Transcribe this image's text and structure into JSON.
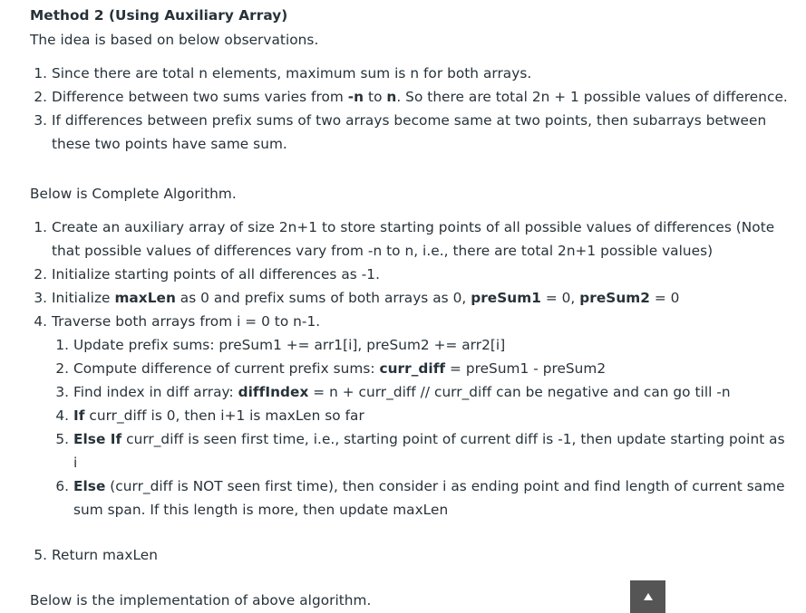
{
  "heading": "Method 2 (Using Auxiliary Array)",
  "intro": "The idea is based on below observations.",
  "observations": {
    "o1": "Since there are total n elements, maximum sum is n for both arrays.",
    "o2": {
      "a": "Difference between two sums varies from ",
      "b1": "-n",
      "b": " to ",
      "b2": "n",
      "c": ". So there are total 2n + 1 possible values of difference."
    },
    "o3": "If differences between prefix sums of two arrays become same at two points, then subarrays between these two points have same sum."
  },
  "algorithm_intro": "Below is Complete Algorithm.",
  "steps": {
    "s1": "Create an auxiliary array of size 2n+1 to store starting points of all possible values of differences (Note that possible values of differences vary from -n to n, i.e., there are total 2n+1 possible values)",
    "s2": "Initialize starting points of all differences as -1.",
    "s3": {
      "a": "Initialize ",
      "b1": "maxLen",
      "b": " as 0 and prefix sums of both arrays as 0, ",
      "b2": "preSum1",
      "c": " = 0, ",
      "b3": "preSum2",
      "d": " = 0"
    },
    "s4": "Traverse both arrays from i = 0 to n-1.",
    "substeps": {
      "t1": "Update prefix sums: preSum1 += arr1[i], preSum2 += arr2[i]",
      "t2": {
        "a": "Compute difference of current prefix sums: ",
        "b1": "curr_diff",
        "c": " = preSum1 - preSum2"
      },
      "t3": {
        "a": "Find index in diff array: ",
        "b1": "diffIndex",
        "c": " = n + curr_diff // curr_diff can be negative and can go till -n"
      },
      "t4": {
        "b1": "If",
        "c": " curr_diff is 0, then i+1 is maxLen so far"
      },
      "t5": {
        "b1": "Else If",
        "c": " curr_diff is seen first time, i.e., starting point of current diff is -1, then update starting point as i"
      },
      "t6": {
        "b1": "Else",
        "c": " (curr_diff is NOT seen first time), then consider i as ending point and find length of current same sum span. If this length is more, then update maxLen"
      }
    },
    "s5": "Return maxLen"
  },
  "implementation_intro": "Below is the implementation of above algorithm.",
  "scroll_top": {
    "icon": "up-arrow-icon",
    "background": "#555555"
  }
}
